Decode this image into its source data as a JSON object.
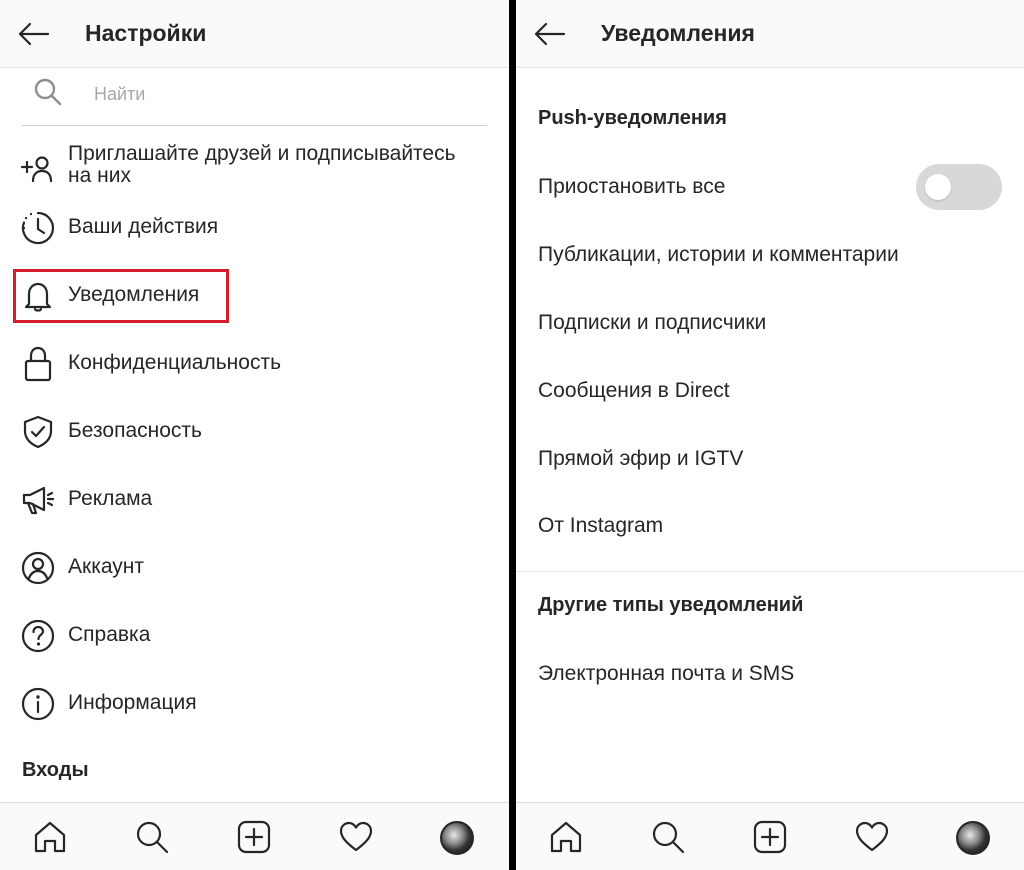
{
  "left": {
    "title": "Настройки",
    "search": {
      "placeholder": "Найти",
      "value": ""
    },
    "menu": [
      {
        "label": "Приглашайте друзей и подписывайтесь на них",
        "icon": "add-person-icon"
      },
      {
        "label": "Ваши действия",
        "icon": "activity-clock-icon"
      },
      {
        "label": "Уведомления",
        "icon": "bell-icon",
        "highlighted": true
      },
      {
        "label": "Конфиденциальность",
        "icon": "lock-icon"
      },
      {
        "label": "Безопасность",
        "icon": "shield-check-icon"
      },
      {
        "label": "Реклама",
        "icon": "megaphone-icon"
      },
      {
        "label": "Аккаунт",
        "icon": "user-circle-icon"
      },
      {
        "label": "Справка",
        "icon": "question-circle-icon"
      },
      {
        "label": "Информация",
        "icon": "info-circle-icon"
      }
    ],
    "section": "Входы"
  },
  "right": {
    "title": "Уведомления",
    "push_heading": "Push-уведомления",
    "pause_all": {
      "label": "Приостановить все",
      "enabled": false
    },
    "push_items": [
      "Публикации, истории и комментарии",
      "Подписки и подписчики",
      "Сообщения в Direct",
      "Прямой эфир и IGTV",
      "От Instagram"
    ],
    "other_heading": "Другие типы уведомлений",
    "other_items": [
      "Электронная почта и SMS"
    ]
  },
  "tabbar": [
    "home-icon",
    "search-icon",
    "new-post-icon",
    "heart-icon",
    "profile-avatar"
  ],
  "colors": {
    "highlight": "#d0202d",
    "text": "#262626",
    "toggle_off": "#d8d8d8"
  }
}
